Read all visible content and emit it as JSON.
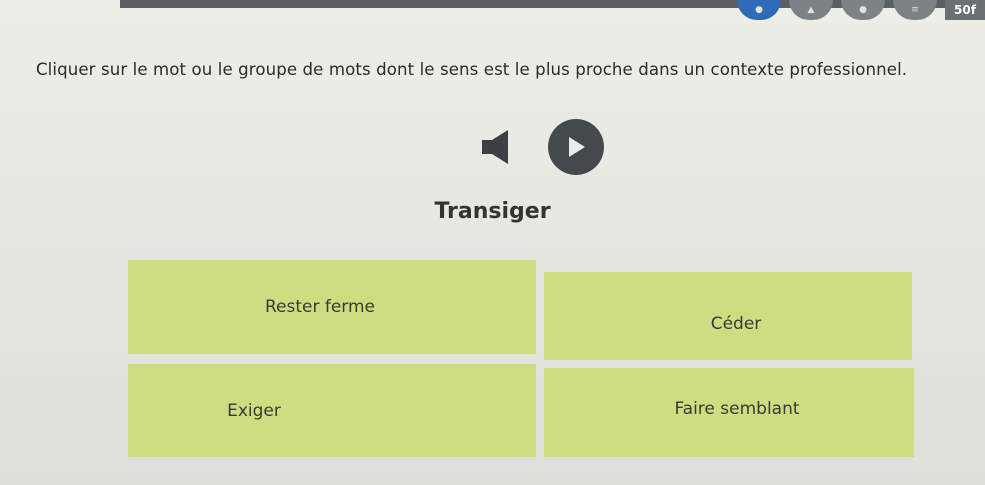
{
  "header": {
    "score_label": "50f",
    "icons": [
      "blue-tool-icon",
      "tool-icon",
      "tool-icon",
      "tool-icon"
    ]
  },
  "instruction": "Cliquer sur le mot ou le groupe de mots dont le sens est le plus proche dans un contexte professionnel.",
  "audio": {
    "speaker_icon": "speaker-icon",
    "play_icon": "play-icon"
  },
  "question": {
    "word": "Transiger"
  },
  "answers": [
    {
      "label": "Rester ferme"
    },
    {
      "label": "Céder"
    },
    {
      "label": "Exiger"
    },
    {
      "label": "Faire semblant"
    }
  ],
  "colors": {
    "answer_background": "#cddd7f",
    "play_button": "#44494d",
    "top_bar": "#5b5f63",
    "accent_blue": "#2f6bb7"
  }
}
